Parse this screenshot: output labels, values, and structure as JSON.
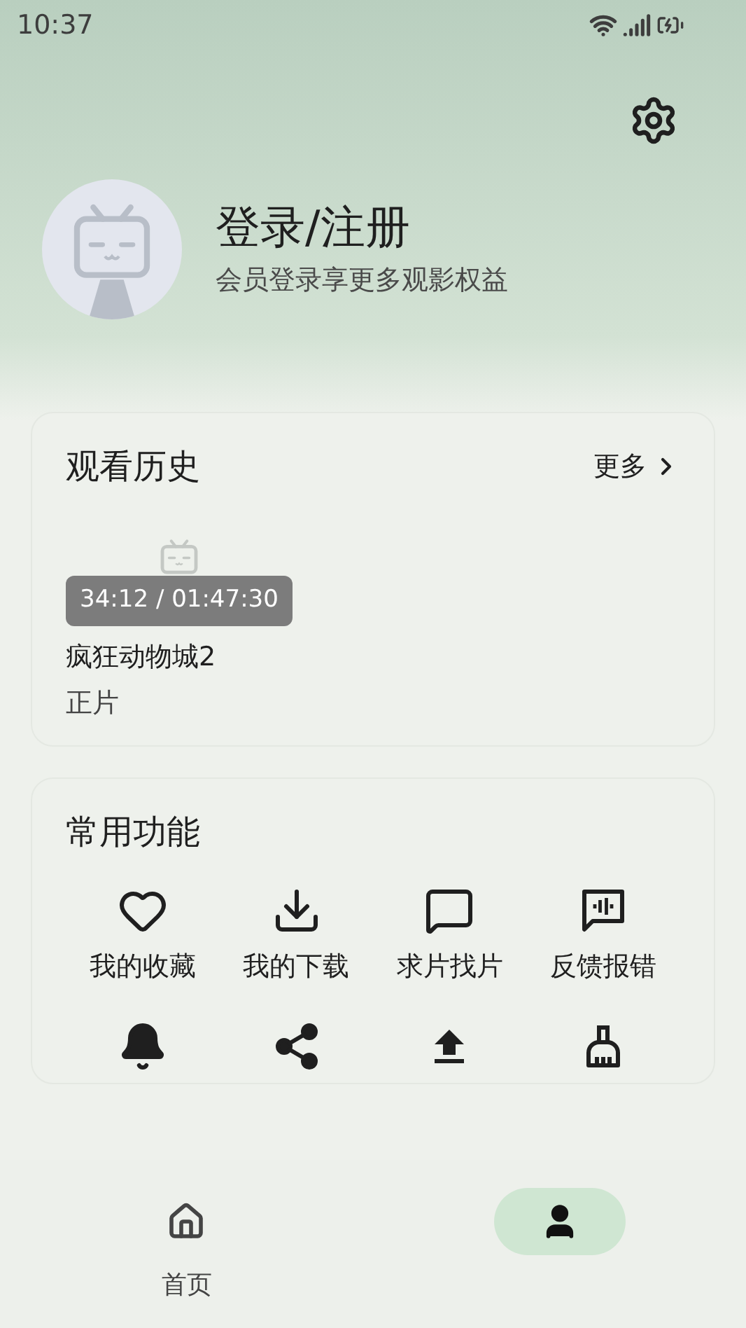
{
  "status_bar": {
    "time": "10:37"
  },
  "profile": {
    "title": "登录/注册",
    "subtitle": "会员登录享更多观影权益"
  },
  "history": {
    "title": "观看历史",
    "more": "更多",
    "items": [
      {
        "progress": "34:12 / 01:47:30",
        "title": "疯狂动物城2",
        "episode": "正片"
      }
    ]
  },
  "functions": {
    "title": "常用功能",
    "items": [
      {
        "kind": "labeled",
        "label": "我的收藏"
      },
      {
        "kind": "labeled",
        "label": "我的下载"
      },
      {
        "kind": "labeled",
        "label": "求片找片"
      },
      {
        "kind": "labeled",
        "label": "反馈报错"
      },
      {
        "kind": "icon"
      },
      {
        "kind": "icon"
      },
      {
        "kind": "icon"
      },
      {
        "kind": "icon"
      }
    ]
  },
  "nav": [
    {
      "label": "首页",
      "selected": false
    },
    {
      "selected": true
    }
  ]
}
